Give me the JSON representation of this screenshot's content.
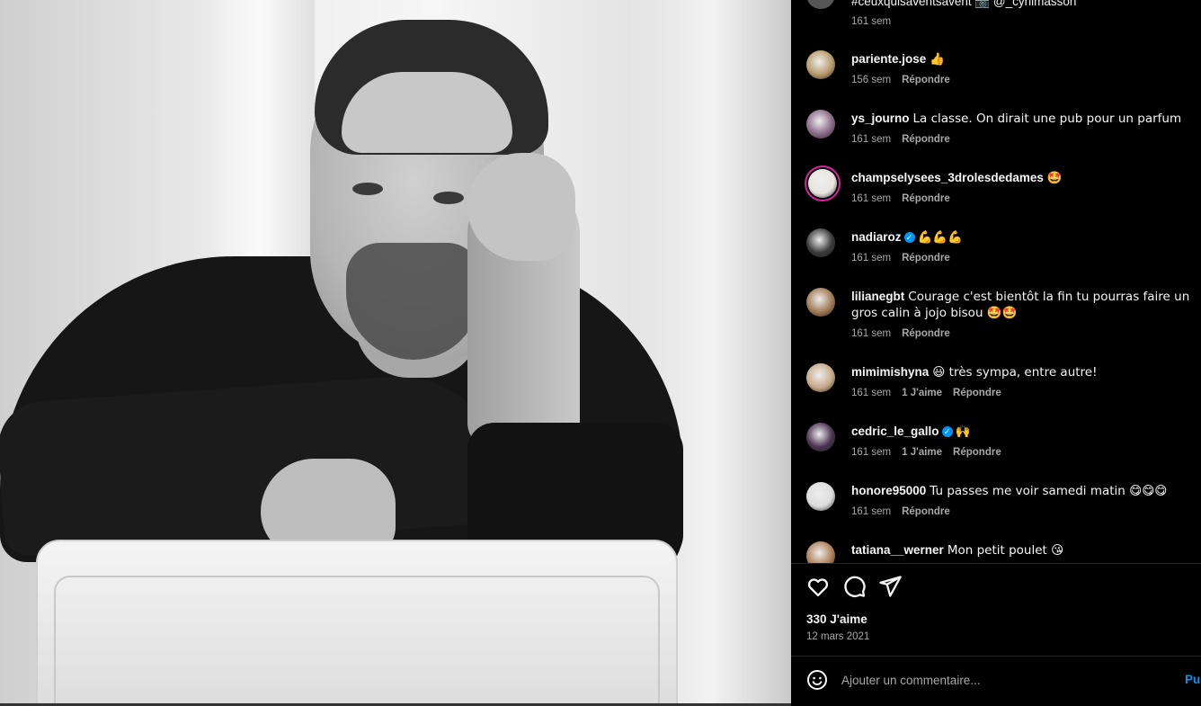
{
  "photo": {
    "alt": ""
  },
  "top_comment": {
    "text": "#ceuxquisaventsavent 📷 @_cyrilmasson",
    "time": "161 sem"
  },
  "comments": [
    {
      "user": "pariente.jose",
      "verified": false,
      "text": "👍",
      "time": "156 sem",
      "likes": "",
      "reply": "Répondre",
      "avatar_color": "#b89a6a"
    },
    {
      "user": "ys_journo",
      "verified": false,
      "text": "La classe. On dirait une pub pour un parfum",
      "time": "161 sem",
      "likes": "",
      "reply": "Répondre",
      "avatar_color": "#8a6a88"
    },
    {
      "user": "champselysees_3drolesdedames",
      "verified": false,
      "text": "🤩",
      "time": "161 sem",
      "likes": "",
      "reply": "Répondre",
      "avatar_color": "#e9e6e0"
    },
    {
      "user": "nadiaroz",
      "verified": true,
      "text": "💪💪💪",
      "time": "161 sem",
      "likes": "",
      "reply": "Répondre",
      "avatar_color": "#3a3a3a"
    },
    {
      "user": "lilianegbt",
      "verified": false,
      "text": "Courage c'est bientôt la fin tu pourras faire un gros calin à jojo bisou 🤩🤩",
      "time": "161 sem",
      "likes": "",
      "reply": "Répondre",
      "avatar_color": "#a07a55"
    },
    {
      "user": "mimimishyna",
      "verified": false,
      "text": "😃 très sympa, entre autre!",
      "time": "161 sem",
      "likes": "1 J'aime",
      "reply": "Répondre",
      "avatar_color": "#caa98a"
    },
    {
      "user": "cedric_le_gallo",
      "verified": true,
      "text": "🙌",
      "time": "161 sem",
      "likes": "1 J'aime",
      "reply": "Répondre",
      "avatar_color": "#4b3350"
    },
    {
      "user": "honore95000",
      "verified": false,
      "text": "Tu passes me voir samedi matin 😋😋😋",
      "time": "161 sem",
      "likes": "",
      "reply": "Répondre",
      "avatar_color": "#dcdcdc"
    },
    {
      "user": "tatiana__werner",
      "verified": false,
      "text": "Mon petit poulet 😘",
      "time": "",
      "likes": "",
      "reply": "",
      "avatar_color": "#b0805a"
    }
  ],
  "actions": {
    "like": "heart-icon",
    "comment": "comment-icon",
    "share": "share-icon"
  },
  "post": {
    "likes": "330 J'aime",
    "date": "12 mars 2021"
  },
  "composer": {
    "placeholder": "Ajouter un commentaire...",
    "post_label": "Publier"
  },
  "colors": {
    "accent": "#0095f6",
    "muted": "#a8a8a8",
    "text": "#f5f5f5",
    "background": "#000000"
  }
}
